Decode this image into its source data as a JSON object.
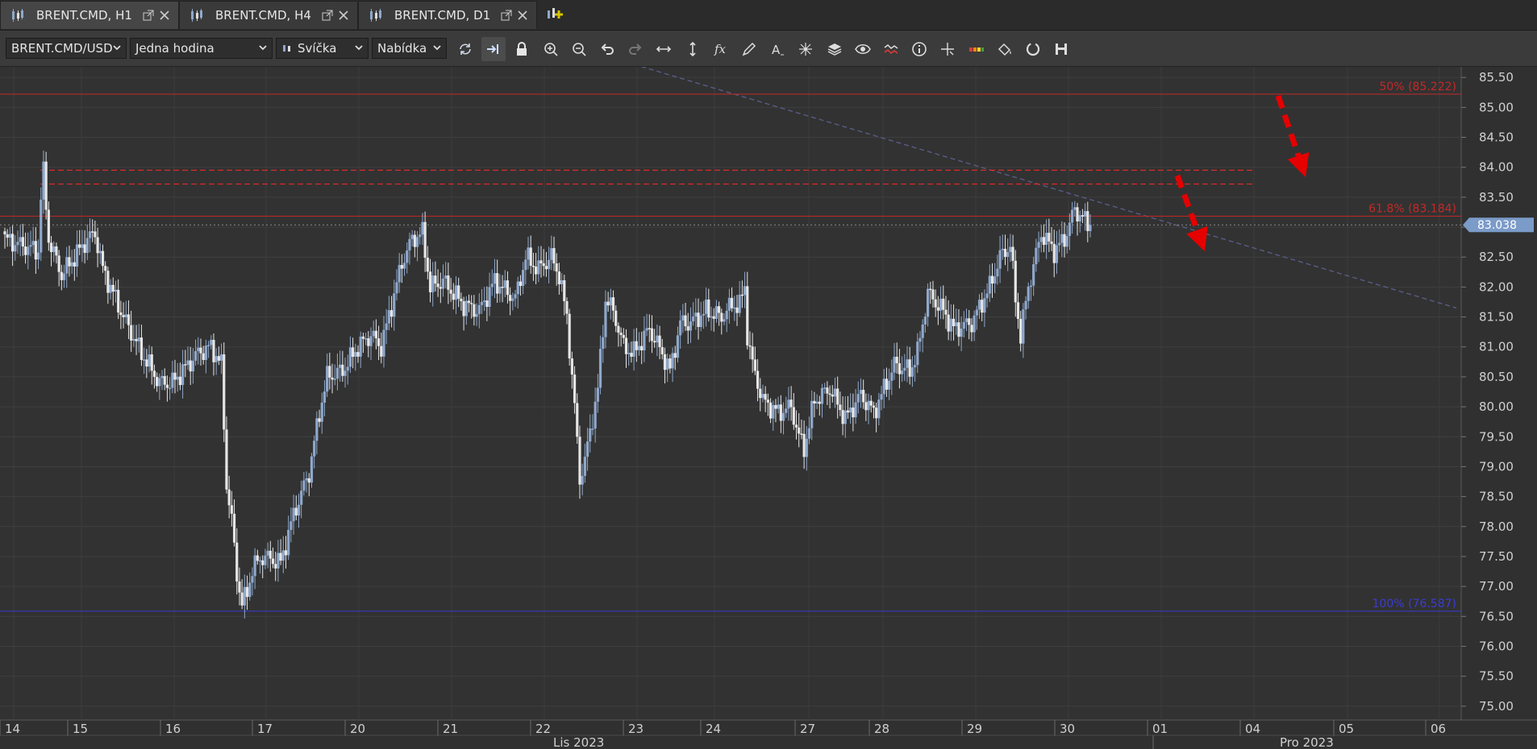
{
  "tabs": [
    {
      "label": "BRENT.CMD, H1",
      "active": true
    },
    {
      "label": "BRENT.CMD, H4",
      "active": false
    },
    {
      "label": "BRENT.CMD, D1",
      "active": false
    }
  ],
  "toolbar": {
    "instrument": "BRENT.CMD/USD",
    "period": "Jedna hodina",
    "chart_type": "Svíčka",
    "price_side": "Nabídka",
    "icons": [
      "refresh-icon",
      "autoshift-icon",
      "lock-icon",
      "zoom-in-icon",
      "zoom-out-icon",
      "undo-icon",
      "redo-icon",
      "horizontal-scale-icon",
      "vertical-scale-icon",
      "indicators-icon",
      "pencil-icon",
      "text-icon",
      "patterns-icon",
      "layers-icon",
      "eye-icon",
      "signals-icon",
      "info-icon",
      "crosshair-icon",
      "color-bars-icon",
      "paint-icon",
      "reset-icon",
      "save-icon"
    ]
  },
  "colors": {
    "background": "#323232",
    "bull": "#8fa8cc",
    "bear": "#e6e6e6",
    "fib": "#c62828",
    "fib_low": "#3b3bd6",
    "resistance": "#d82a2a",
    "trend": "#5a5f8a",
    "arrow": "#e60000",
    "price_badge": "#7b9bc8"
  },
  "chart_data": {
    "type": "candlestick",
    "ylim": [
      74.85,
      85.65
    ],
    "y_ticks": [
      "85.50",
      "85.00",
      "84.50",
      "84.00",
      "83.50",
      "83.00",
      "82.50",
      "82.00",
      "81.50",
      "81.00",
      "80.50",
      "80.00",
      "79.50",
      "79.00",
      "78.50",
      "78.00",
      "77.50",
      "77.00",
      "76.50",
      "76.00",
      "75.50",
      "75.00"
    ],
    "x_labels": [
      "14",
      "15",
      "16",
      "17",
      "20",
      "21",
      "22",
      "23",
      "24",
      "27",
      "28",
      "29",
      "30",
      "01",
      "04",
      "05",
      "06"
    ],
    "month_labels": [
      "Lis 2023",
      "Pro 2023"
    ],
    "last_price": "83.038",
    "current_price_value": 83.038,
    "fib_levels": [
      {
        "label": "50% (85.222)",
        "value": 85.222
      },
      {
        "label": "61.8% (83.184)",
        "value": 83.184
      },
      {
        "label": "100% (76.587)",
        "value": 76.587
      }
    ],
    "resistance_levels": [
      83.95,
      83.72
    ],
    "trendline": {
      "from_value": 86.6,
      "to_value": 81.65
    },
    "price_path": [
      [
        0,
        82.8
      ],
      [
        13,
        82.6
      ],
      [
        14,
        83.5
      ],
      [
        15,
        83.9
      ],
      [
        17,
        82.8
      ],
      [
        22,
        82.2
      ],
      [
        32,
        82.8
      ],
      [
        35,
        82.9
      ],
      [
        38,
        82.3
      ],
      [
        46,
        81.5
      ],
      [
        53,
        80.9
      ],
      [
        60,
        80.4
      ],
      [
        65,
        80.4
      ],
      [
        75,
        80.9
      ],
      [
        80,
        81.0
      ],
      [
        84,
        80.7
      ],
      [
        86,
        78.7
      ],
      [
        88,
        78.1
      ],
      [
        90,
        77.2
      ],
      [
        92,
        76.7
      ],
      [
        94,
        76.9
      ],
      [
        96,
        77.3
      ],
      [
        100,
        77.5
      ],
      [
        107,
        77.4
      ],
      [
        112,
        78.2
      ],
      [
        118,
        78.9
      ],
      [
        122,
        79.9
      ],
      [
        125,
        80.5
      ],
      [
        131,
        80.6
      ],
      [
        137,
        81.0
      ],
      [
        142,
        81.2
      ],
      [
        146,
        81.0
      ],
      [
        150,
        81.7
      ],
      [
        154,
        82.4
      ],
      [
        158,
        82.8
      ],
      [
        162,
        82.9
      ],
      [
        165,
        82.0
      ],
      [
        170,
        82.1
      ],
      [
        178,
        81.7
      ],
      [
        184,
        81.6
      ],
      [
        190,
        82.1
      ],
      [
        198,
        81.8
      ],
      [
        202,
        82.5
      ],
      [
        207,
        82.3
      ],
      [
        212,
        82.5
      ],
      [
        215,
        82.2
      ],
      [
        218,
        81.5
      ],
      [
        221,
        80.0
      ],
      [
        223,
        78.8
      ],
      [
        225,
        79.1
      ],
      [
        230,
        80.3
      ],
      [
        233,
        81.8
      ],
      [
        236,
        81.6
      ],
      [
        240,
        81.0
      ],
      [
        244,
        80.9
      ],
      [
        250,
        81.3
      ],
      [
        256,
        80.8
      ],
      [
        258,
        80.6
      ],
      [
        262,
        81.4
      ],
      [
        266,
        81.4
      ],
      [
        272,
        81.6
      ],
      [
        278,
        81.5
      ],
      [
        282,
        81.7
      ],
      [
        285,
        81.7
      ],
      [
        287,
        82.0
      ],
      [
        288,
        81.2
      ],
      [
        290,
        80.7
      ],
      [
        294,
        80.1
      ],
      [
        300,
        79.9
      ],
      [
        305,
        80.0
      ],
      [
        308,
        79.5
      ],
      [
        310,
        79.3
      ],
      [
        314,
        80.1
      ],
      [
        320,
        80.3
      ],
      [
        326,
        79.8
      ],
      [
        332,
        80.2
      ],
      [
        337,
        79.9
      ],
      [
        341,
        80.3
      ],
      [
        345,
        80.7
      ],
      [
        351,
        80.6
      ],
      [
        354,
        80.9
      ],
      [
        358,
        81.9
      ],
      [
        364,
        81.6
      ],
      [
        368,
        81.3
      ],
      [
        375,
        81.4
      ],
      [
        382,
        82.0
      ],
      [
        386,
        82.5
      ],
      [
        390,
        82.7
      ],
      [
        392,
        81.8
      ],
      [
        394,
        81.2
      ],
      [
        397,
        82.0
      ],
      [
        402,
        82.9
      ],
      [
        407,
        82.6
      ],
      [
        411,
        82.8
      ],
      [
        415,
        83.3
      ],
      [
        419,
        83.1
      ],
      [
        421,
        83.04
      ]
    ]
  }
}
